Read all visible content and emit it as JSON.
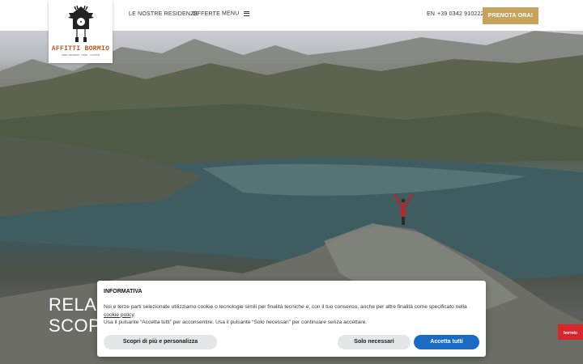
{
  "header": {
    "logo_title": "AFFITTI BORMIO",
    "logo_subtitle": "case vacanza · relax · comfort",
    "nav": [
      "LE NOSTRE RESIDENZE",
      "OFFERTE"
    ],
    "menu_label": "MENU",
    "lang": "EN",
    "phone": "+39 0342 910222",
    "cta": "PRENOTA ORA!"
  },
  "hero": {
    "line1": "RELA",
    "line2": "SCOP"
  },
  "cookie": {
    "title": "INFORMATIVA",
    "text_part1": "Noi e terze parti selezionate utilizziamo cookie o tecnologie simili per finalità tecniche e, con il tuo consenso, anche per altre finalità come specificato nella ",
    "link": "cookie policy",
    "text_part2": ".",
    "text_line2": "Usa il pulsante “Accetta tutti” per acconsentire. Usa il pulsante “Solo necessari” per continuare senza accettare.",
    "btn_customize": "Scopri di più e personalizza",
    "btn_necessary": "Solo necessari",
    "btn_accept": "Accetta tutti"
  },
  "badge": "bormio",
  "colors": {
    "cta": "#c8a35c",
    "accept": "#1a6bc4",
    "logo": "#b5541e",
    "badge": "#d9262b"
  }
}
